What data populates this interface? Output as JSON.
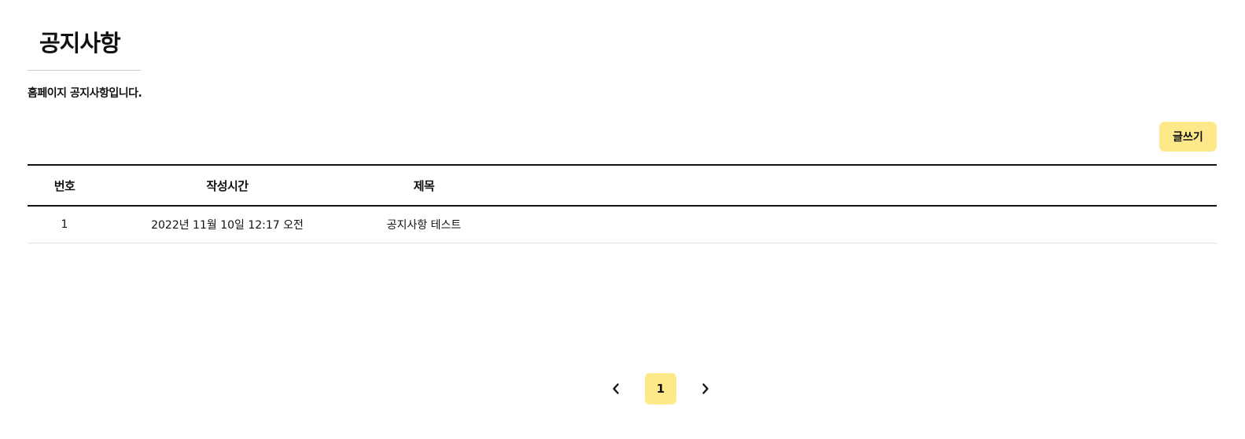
{
  "header": {
    "title": "공지사항",
    "description": "홈페이지 공지사항입니다."
  },
  "toolbar": {
    "write_label": "글쓰기"
  },
  "table": {
    "columns": [
      "번호",
      "작성시간",
      "제목"
    ],
    "rows": [
      {
        "number": "1",
        "created": "2022년 11월 10일 12:17 오전",
        "title": "공지사항 테스트"
      }
    ]
  },
  "pagination": {
    "prev_icon": "chevron-left-icon",
    "current_page": "1",
    "next_icon": "chevron-right-icon"
  },
  "colors": {
    "accent": "#fde98a",
    "text": "#111111",
    "divider": "#e3e3e3"
  }
}
